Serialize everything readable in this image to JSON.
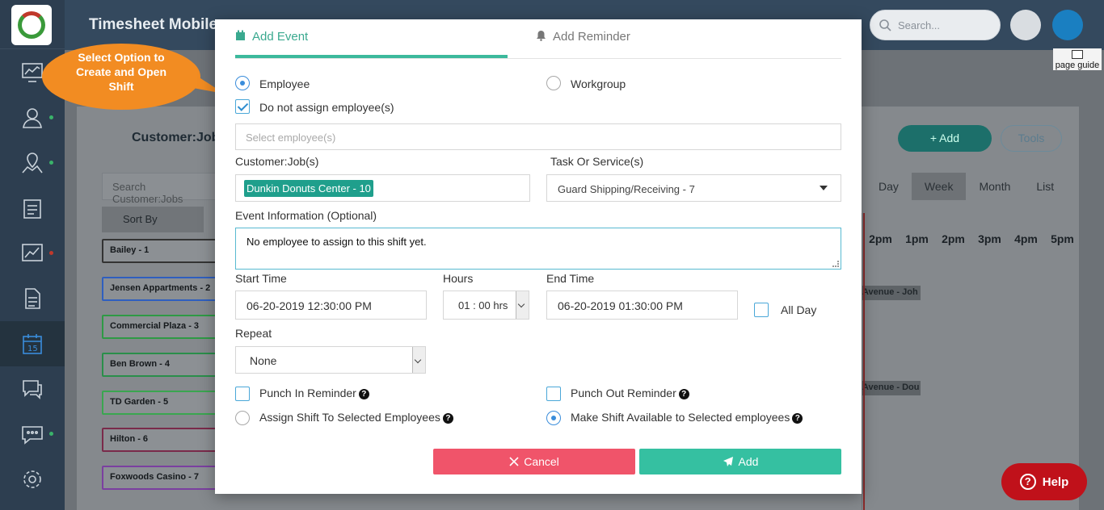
{
  "app": {
    "title": "Timesheet Mobile",
    "search_placeholder": "Search..."
  },
  "background": {
    "page_title": "Customer:Jobs",
    "add_label": "+ Add",
    "tools_label": "Tools",
    "search_placeholder": "Search Customer:Jobs",
    "sort_label": "Sort By",
    "views": [
      "Day",
      "Week",
      "Month",
      "List"
    ],
    "active_view": "Week",
    "hours": [
      "2pm",
      "1pm",
      "2pm",
      "3pm",
      "4pm",
      "5pm"
    ],
    "jobs": [
      {
        "label": "Bailey - 1",
        "color": "#333333"
      },
      {
        "label": "Jensen Appartments - 2",
        "color": "#2f5fbf"
      },
      {
        "label": "Commercial Plaza - 3",
        "color": "#2e9a45"
      },
      {
        "label": "Ben Brown - 4",
        "color": "#2a8f4a"
      },
      {
        "label": "TD Garden - 5",
        "color": "#3aa650"
      },
      {
        "label": "Hilton - 6",
        "color": "#7a2a4a"
      },
      {
        "label": "Foxwoods Casino - 7",
        "color": "#7b3fa0"
      }
    ],
    "events": [
      "Avenue - Joh",
      "Avenue - Dou"
    ]
  },
  "tooltip": {
    "text_line1": "Select Option to",
    "text_line2": "Create and Open",
    "text_line3": "Shift"
  },
  "page_guide": "page guide",
  "help_label": "Help",
  "modal": {
    "tabs": [
      {
        "label": "Add Event",
        "icon": "calendar-icon",
        "active": true
      },
      {
        "label": "Add Reminder",
        "icon": "bell-icon",
        "active": false
      }
    ],
    "assign_type": {
      "employee": "Employee",
      "workgroup": "Workgroup",
      "selected": "Employee"
    },
    "no_assign": {
      "label": "Do not assign employee(s)",
      "checked": true
    },
    "employee_placeholder": "Select employee(s)",
    "customer_job": {
      "label": "Customer:Job(s)",
      "value": "Dunkin Donuts Center - 10"
    },
    "task": {
      "label": "Task Or Service(s)",
      "value": "Guard Shipping/Receiving - 7"
    },
    "event_info": {
      "label": "Event Information (Optional)",
      "value": "No employee to assign to this shift yet."
    },
    "start_time": {
      "label": "Start Time",
      "value": "06-20-2019 12:30:00 PM"
    },
    "hours": {
      "label": "Hours",
      "value": "01 : 00 hrs"
    },
    "end_time": {
      "label": "End Time",
      "value": "06-20-2019 01:30:00 PM"
    },
    "all_day": {
      "label": "All Day",
      "checked": false
    },
    "repeat": {
      "label": "Repeat",
      "value": "None"
    },
    "punch_in": {
      "label": "Punch In Reminder",
      "checked": false
    },
    "punch_out": {
      "label": "Punch Out Reminder",
      "checked": false
    },
    "assign_shift": {
      "label": "Assign Shift To Selected Employees",
      "selected": false
    },
    "make_available": {
      "label": "Make Shift Available to Selected employees",
      "selected": true
    },
    "cancel_label": "Cancel",
    "add_label": "Add"
  },
  "colors": {
    "accent": "#3cb99c",
    "cancel": "#f0546a",
    "add": "#35c0a1",
    "tooltip": "#f28c22",
    "help": "#c0111a"
  }
}
